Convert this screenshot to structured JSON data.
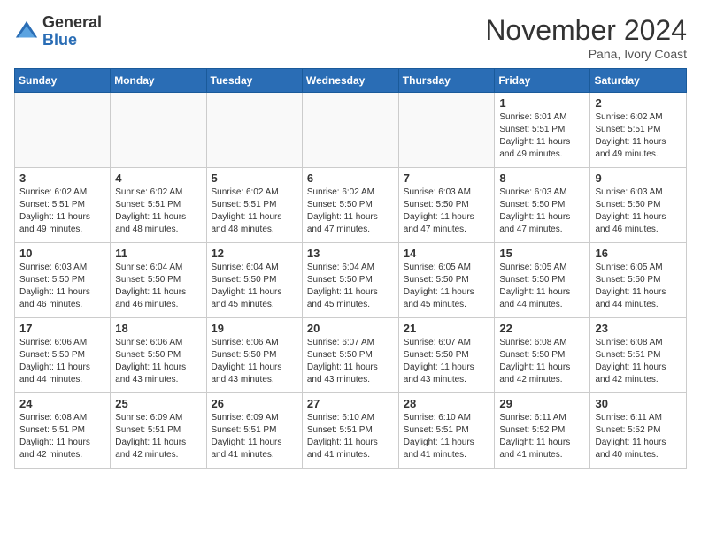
{
  "header": {
    "logo_general": "General",
    "logo_blue": "Blue",
    "month_title": "November 2024",
    "location": "Pana, Ivory Coast"
  },
  "calendar": {
    "days_of_week": [
      "Sunday",
      "Monday",
      "Tuesday",
      "Wednesday",
      "Thursday",
      "Friday",
      "Saturday"
    ],
    "weeks": [
      [
        {
          "day": "",
          "info": ""
        },
        {
          "day": "",
          "info": ""
        },
        {
          "day": "",
          "info": ""
        },
        {
          "day": "",
          "info": ""
        },
        {
          "day": "",
          "info": ""
        },
        {
          "day": "1",
          "info": "Sunrise: 6:01 AM\nSunset: 5:51 PM\nDaylight: 11 hours\nand 49 minutes."
        },
        {
          "day": "2",
          "info": "Sunrise: 6:02 AM\nSunset: 5:51 PM\nDaylight: 11 hours\nand 49 minutes."
        }
      ],
      [
        {
          "day": "3",
          "info": "Sunrise: 6:02 AM\nSunset: 5:51 PM\nDaylight: 11 hours\nand 49 minutes."
        },
        {
          "day": "4",
          "info": "Sunrise: 6:02 AM\nSunset: 5:51 PM\nDaylight: 11 hours\nand 48 minutes."
        },
        {
          "day": "5",
          "info": "Sunrise: 6:02 AM\nSunset: 5:51 PM\nDaylight: 11 hours\nand 48 minutes."
        },
        {
          "day": "6",
          "info": "Sunrise: 6:02 AM\nSunset: 5:50 PM\nDaylight: 11 hours\nand 47 minutes."
        },
        {
          "day": "7",
          "info": "Sunrise: 6:03 AM\nSunset: 5:50 PM\nDaylight: 11 hours\nand 47 minutes."
        },
        {
          "day": "8",
          "info": "Sunrise: 6:03 AM\nSunset: 5:50 PM\nDaylight: 11 hours\nand 47 minutes."
        },
        {
          "day": "9",
          "info": "Sunrise: 6:03 AM\nSunset: 5:50 PM\nDaylight: 11 hours\nand 46 minutes."
        }
      ],
      [
        {
          "day": "10",
          "info": "Sunrise: 6:03 AM\nSunset: 5:50 PM\nDaylight: 11 hours\nand 46 minutes."
        },
        {
          "day": "11",
          "info": "Sunrise: 6:04 AM\nSunset: 5:50 PM\nDaylight: 11 hours\nand 46 minutes."
        },
        {
          "day": "12",
          "info": "Sunrise: 6:04 AM\nSunset: 5:50 PM\nDaylight: 11 hours\nand 45 minutes."
        },
        {
          "day": "13",
          "info": "Sunrise: 6:04 AM\nSunset: 5:50 PM\nDaylight: 11 hours\nand 45 minutes."
        },
        {
          "day": "14",
          "info": "Sunrise: 6:05 AM\nSunset: 5:50 PM\nDaylight: 11 hours\nand 45 minutes."
        },
        {
          "day": "15",
          "info": "Sunrise: 6:05 AM\nSunset: 5:50 PM\nDaylight: 11 hours\nand 44 minutes."
        },
        {
          "day": "16",
          "info": "Sunrise: 6:05 AM\nSunset: 5:50 PM\nDaylight: 11 hours\nand 44 minutes."
        }
      ],
      [
        {
          "day": "17",
          "info": "Sunrise: 6:06 AM\nSunset: 5:50 PM\nDaylight: 11 hours\nand 44 minutes."
        },
        {
          "day": "18",
          "info": "Sunrise: 6:06 AM\nSunset: 5:50 PM\nDaylight: 11 hours\nand 43 minutes."
        },
        {
          "day": "19",
          "info": "Sunrise: 6:06 AM\nSunset: 5:50 PM\nDaylight: 11 hours\nand 43 minutes."
        },
        {
          "day": "20",
          "info": "Sunrise: 6:07 AM\nSunset: 5:50 PM\nDaylight: 11 hours\nand 43 minutes."
        },
        {
          "day": "21",
          "info": "Sunrise: 6:07 AM\nSunset: 5:50 PM\nDaylight: 11 hours\nand 43 minutes."
        },
        {
          "day": "22",
          "info": "Sunrise: 6:08 AM\nSunset: 5:50 PM\nDaylight: 11 hours\nand 42 minutes."
        },
        {
          "day": "23",
          "info": "Sunrise: 6:08 AM\nSunset: 5:51 PM\nDaylight: 11 hours\nand 42 minutes."
        }
      ],
      [
        {
          "day": "24",
          "info": "Sunrise: 6:08 AM\nSunset: 5:51 PM\nDaylight: 11 hours\nand 42 minutes."
        },
        {
          "day": "25",
          "info": "Sunrise: 6:09 AM\nSunset: 5:51 PM\nDaylight: 11 hours\nand 42 minutes."
        },
        {
          "day": "26",
          "info": "Sunrise: 6:09 AM\nSunset: 5:51 PM\nDaylight: 11 hours\nand 41 minutes."
        },
        {
          "day": "27",
          "info": "Sunrise: 6:10 AM\nSunset: 5:51 PM\nDaylight: 11 hours\nand 41 minutes."
        },
        {
          "day": "28",
          "info": "Sunrise: 6:10 AM\nSunset: 5:51 PM\nDaylight: 11 hours\nand 41 minutes."
        },
        {
          "day": "29",
          "info": "Sunrise: 6:11 AM\nSunset: 5:52 PM\nDaylight: 11 hours\nand 41 minutes."
        },
        {
          "day": "30",
          "info": "Sunrise: 6:11 AM\nSunset: 5:52 PM\nDaylight: 11 hours\nand 40 minutes."
        }
      ]
    ]
  }
}
